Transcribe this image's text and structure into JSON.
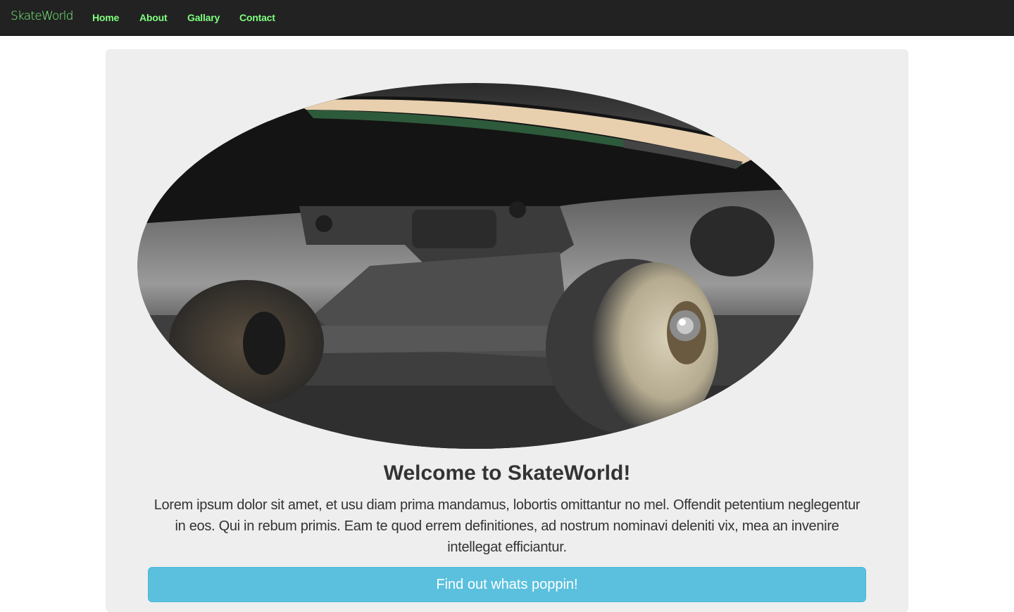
{
  "navbar": {
    "brand": "SkateWorld",
    "links": [
      "Home",
      "About",
      "Gallary",
      "Contact"
    ]
  },
  "hero": {
    "image": "skateboard-truck-wheels-photo",
    "headline": "Welcome to SkateWorld!",
    "lead": "Lorem ipsum dolor sit amet, et usu diam prima mandamus, lobortis omittantur no mel. Offendit petentium neglegentur in eos. Qui in rebum primis. Eam te quod errem definitiones, ad nostrum nominavi deleniti vix, mea an invenire intellegat efficiantur.",
    "cta_label": "Find out whats poppin!"
  },
  "colors": {
    "navbar_bg": "#222222",
    "nav_text": "#7fff7f",
    "jumbotron_bg": "#eeeeee",
    "cta_bg": "#5bc0de"
  }
}
